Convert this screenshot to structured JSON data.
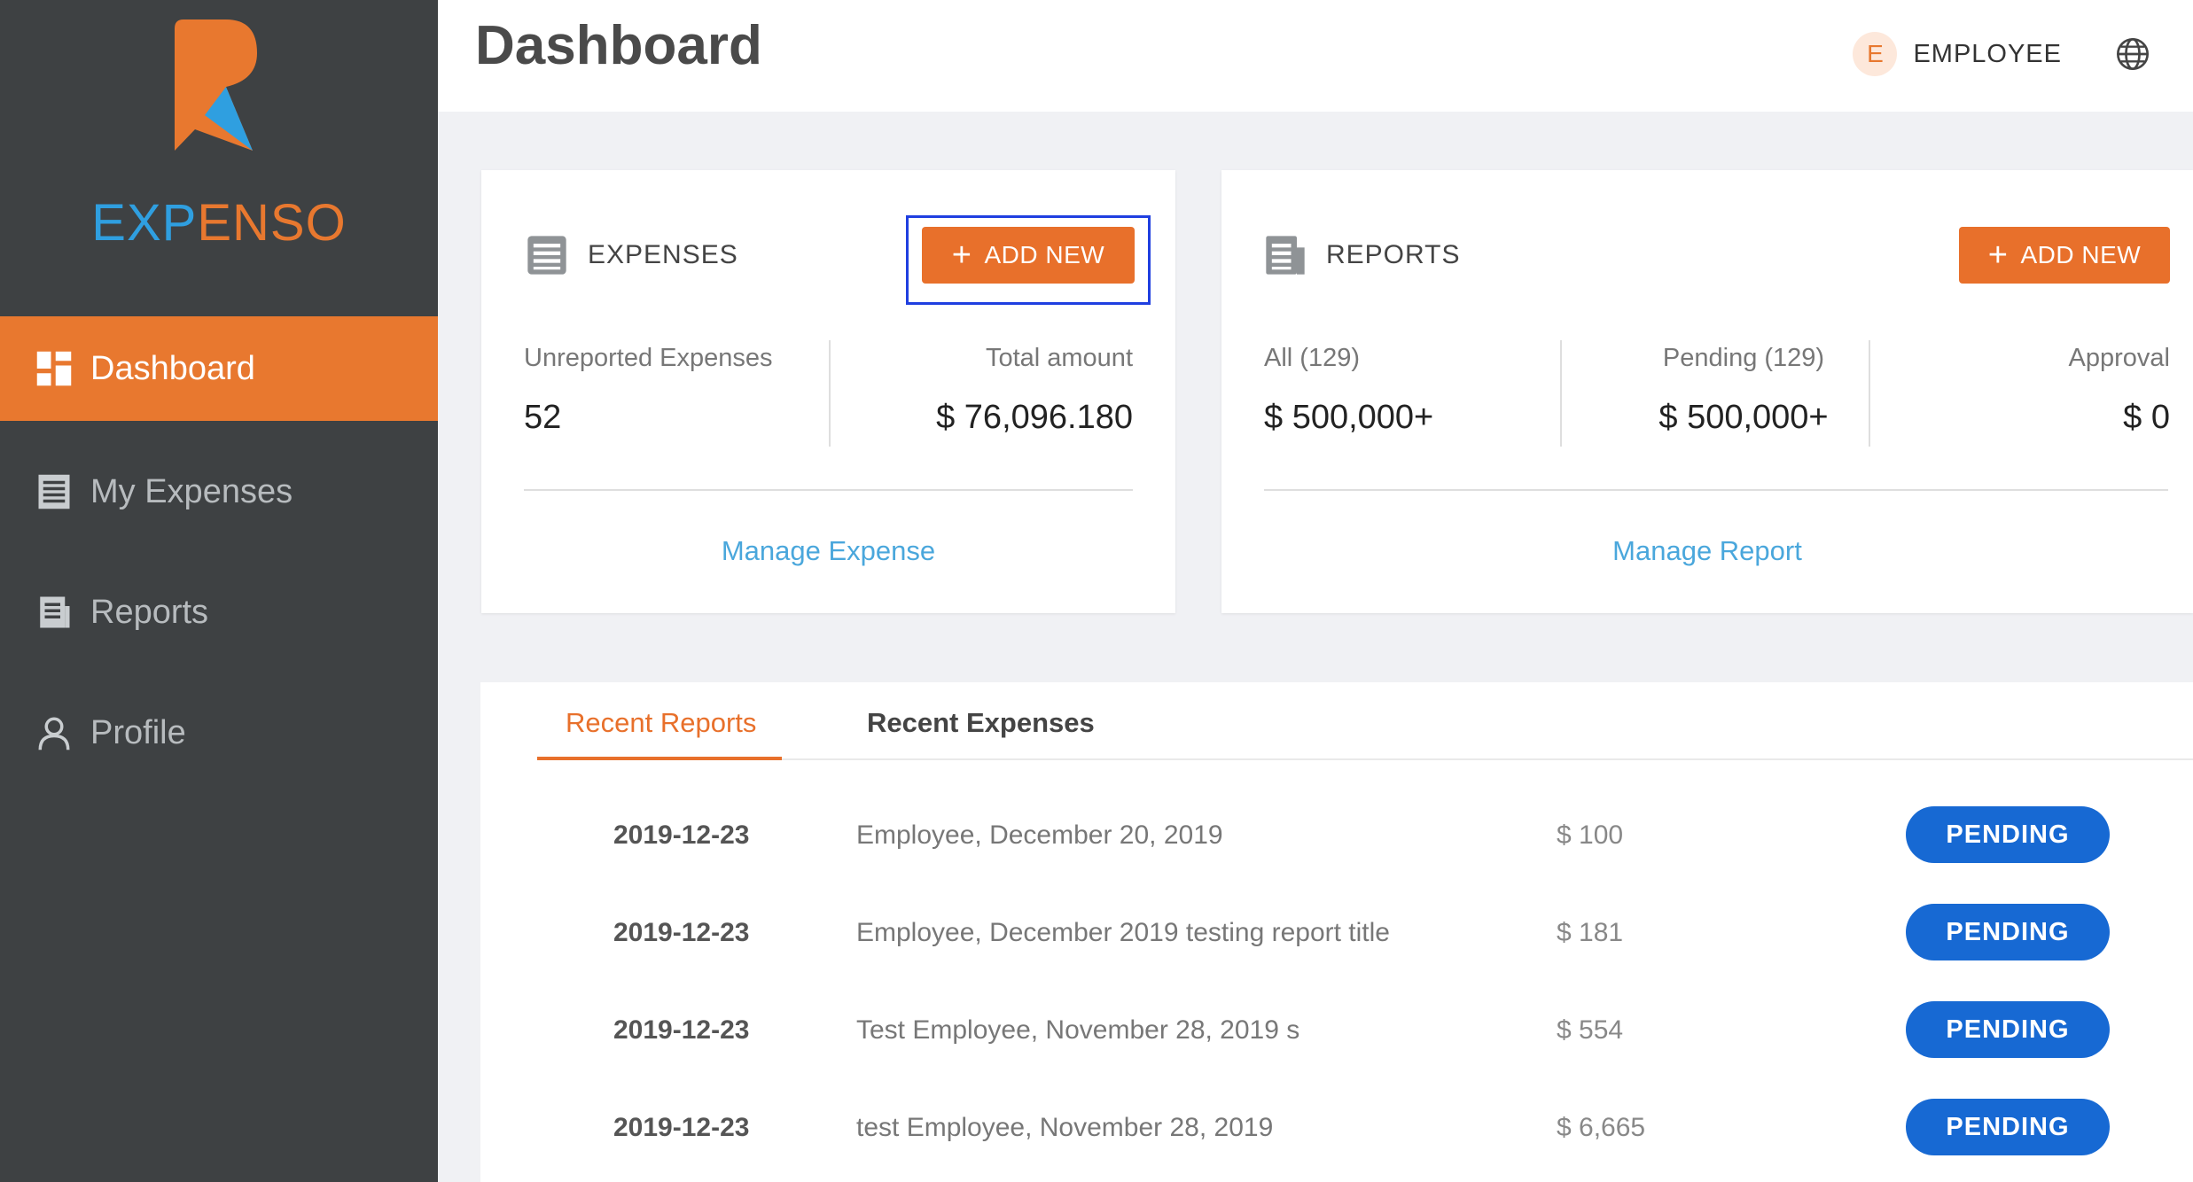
{
  "brand": {
    "part1": "EXP",
    "part2": "ENSO",
    "accent": "#e8782f",
    "secondary": "#2f9fe0"
  },
  "sidebar": {
    "items": [
      {
        "label": "Dashboard",
        "icon": "dashboard-icon",
        "active": true
      },
      {
        "label": "My Expenses",
        "icon": "expenses-icon",
        "active": false
      },
      {
        "label": "Reports",
        "icon": "reports-icon",
        "active": false
      },
      {
        "label": "Profile",
        "icon": "profile-icon",
        "active": false
      }
    ]
  },
  "header": {
    "title": "Dashboard",
    "avatar_initial": "E",
    "user": "EMPLOYEE",
    "globe_icon": "globe-icon"
  },
  "expenses_card": {
    "title": "EXPENSES",
    "add_label": "ADD NEW",
    "stats": [
      {
        "label": "Unreported Expenses",
        "value": "52"
      },
      {
        "label": "Total amount",
        "value": "$ 76,096.180"
      }
    ],
    "link": "Manage Expense"
  },
  "reports_card": {
    "title": "REPORTS",
    "add_label": "ADD NEW",
    "stats": [
      {
        "label": "All (129)",
        "value": "$ 500,000+"
      },
      {
        "label": "Pending (129)",
        "value": "$ 500,000+"
      },
      {
        "label": "Approval",
        "value": "$ 0"
      }
    ],
    "link": "Manage Report"
  },
  "recent": {
    "tabs": [
      {
        "label": "Recent Reports",
        "active": true
      },
      {
        "label": "Recent Expenses",
        "active": false
      }
    ],
    "rows": [
      {
        "date": "2019-12-23",
        "desc": "Employee, December 20, 2019",
        "amount": "$ 100",
        "status": "PENDING"
      },
      {
        "date": "2019-12-23",
        "desc": "Employee, December 2019 testing report title",
        "amount": "$ 181",
        "status": "PENDING"
      },
      {
        "date": "2019-12-23",
        "desc": "Test Employee, November 28, 2019 s",
        "amount": "$ 554",
        "status": "PENDING"
      },
      {
        "date": "2019-12-23",
        "desc": "test Employee, November 28, 2019",
        "amount": "$ 6,665",
        "status": "PENDING"
      }
    ],
    "status_color": "#1769d3"
  }
}
